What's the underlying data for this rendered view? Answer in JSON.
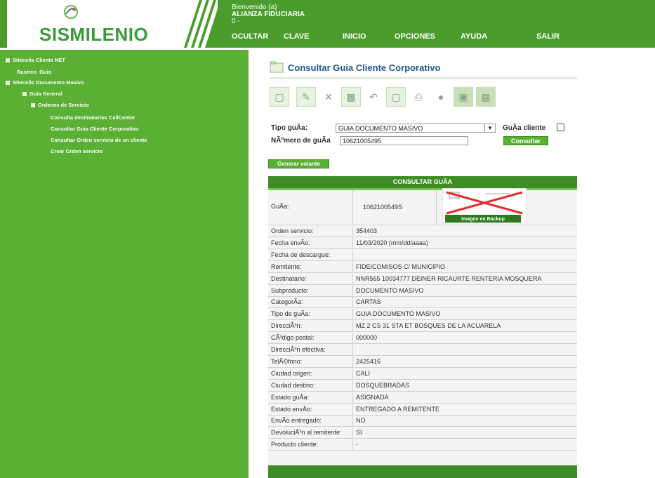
{
  "header": {
    "logo_text": "SISMILENIO",
    "welcome_line1": "Bienvenido (a)",
    "welcome_line2": "ALIANZA FIDUCIARIA",
    "welcome_line3": "0 -",
    "nav": [
      "OCULTAR",
      "CLAVE",
      "INICIO",
      "OPCIONES",
      "AYUDA",
      "SALIR"
    ]
  },
  "sidebar": {
    "items": [
      "Sitecolis Cliente NET",
      "Rastreo_Guia",
      "Sitecolis Documento Masivo",
      "Guia General",
      "Ordenes de Servicio",
      "Consulta destinatarios CallCenter",
      "Consultar Guia Cliente Corporativo",
      "Consultar Orden servicio de un cliente",
      "Crear Orden servicio"
    ]
  },
  "page": {
    "title": "Consultar Guia Cliente Corporativo"
  },
  "toolbar": {
    "icons": [
      "new-icon",
      "edit-icon",
      "delete-icon",
      "save-icon",
      "undo-icon",
      "preview-icon",
      "print-icon",
      "attach-icon",
      "screen-icon",
      "export-icon"
    ]
  },
  "form": {
    "tipo_label": "Tipo guÃ­a:",
    "tipo_value": "GUIA DOCUMENTO MASIVO",
    "guia_cliente_label": "GuÃ­a cliente",
    "numero_label": "NÃºmero de guÃ­a",
    "numero_value": "10621005495",
    "consultar_label": "Consultar",
    "generar_label": "Generar volante"
  },
  "table": {
    "header": "CONSULTAR GUÃA",
    "guia_label": "GuÃ­a:",
    "guia_value": "1062100549S",
    "image_caption": "Imagen en Backup",
    "rows": [
      {
        "k": "Orden servicio:",
        "v": "354403"
      },
      {
        "k": "Fecha envÃ­o:",
        "v": "11/03/2020 (mm/dd/aaaa)"
      },
      {
        "k": "Fecha de descargue:",
        "v": ""
      },
      {
        "k": "Remitente:",
        "v": "FIDEICOMISOS C/ MUNICIPIO"
      },
      {
        "k": "Destinatario:",
        "v": "NNR565 10034777 DEINER RICAURTE RENTERIA MOSQUERA"
      },
      {
        "k": "Subproducto:",
        "v": "DOCUMENTO MASIVO"
      },
      {
        "k": "CategorÃ­a:",
        "v": "CARTAS"
      },
      {
        "k": "Tipo de guÃ­a:",
        "v": "GUIA DOCUMENTO MASIVO"
      },
      {
        "k": "DirecciÃ³n:",
        "v": "MZ 2 CS 31 STA ET BOSQUES DE LA ACUARELA"
      },
      {
        "k": "CÃ³digo postal:",
        "v": "000000"
      },
      {
        "k": "DirecciÃ³n efectiva:",
        "v": ""
      },
      {
        "k": "TelÃ©fono:",
        "v": "2425416"
      },
      {
        "k": "Ciudad origen:",
        "v": "CALI"
      },
      {
        "k": "Ciudad destino:",
        "v": "DOSQUEBRADAS"
      },
      {
        "k": "Estado guÃ­a:",
        "v": "ASIGNADA"
      },
      {
        "k": "Estado envÃ­o:",
        "v": "ENTREGADO A REMITENTE"
      },
      {
        "k": "EnvÃ­o entregado:",
        "v": "NO"
      },
      {
        "k": "DevoluciÃ³n al remitente:",
        "v": "SI"
      },
      {
        "k": "Producto cliente:",
        "v": "-"
      }
    ]
  }
}
